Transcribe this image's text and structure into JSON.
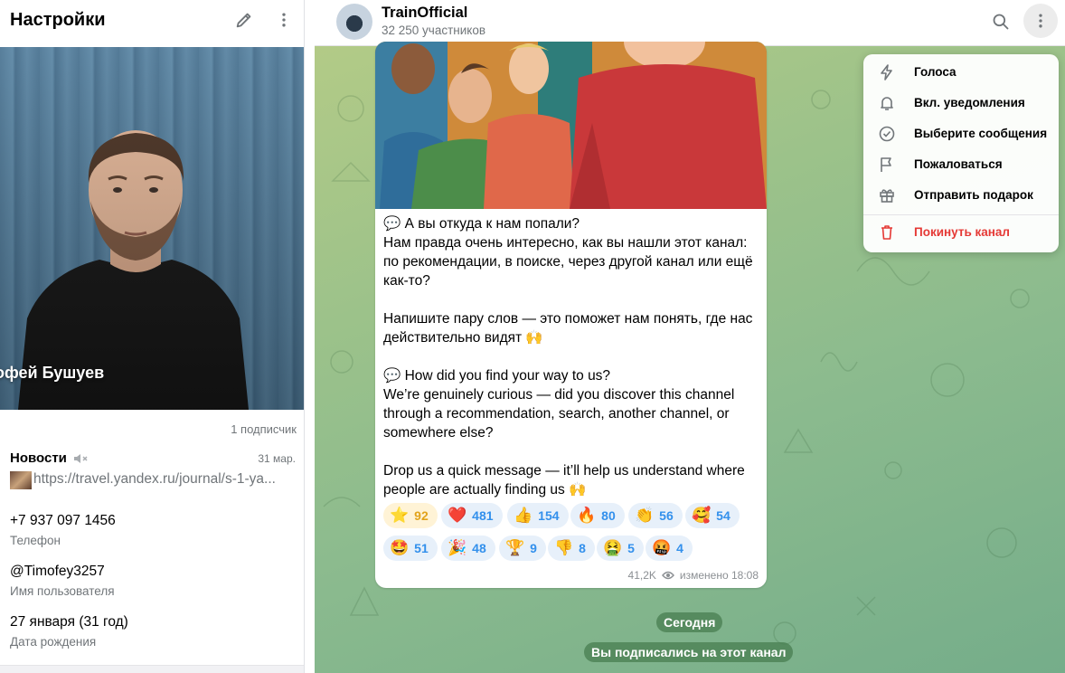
{
  "left_panel": {
    "title": "Настройки",
    "profile_name": "офей Бушуев",
    "subscribers": "1 подписчик",
    "news": {
      "title": "Новости",
      "date": "31 мар.",
      "link": "https://travel.yandex.ru/journal/s-1-ya..."
    },
    "phone": {
      "value": "+7 937 097 1456",
      "label": "Телефон"
    },
    "username": {
      "value": "@Timofey3257",
      "label": "Имя пользователя"
    },
    "birthday": {
      "value": "27 января (31 год)",
      "label": "Дата рождения"
    }
  },
  "chat": {
    "channel_name": "TrainOfficial",
    "members": "32 250 участников",
    "message": {
      "text": "💬 А вы откуда к нам попали?\nНам правда очень интересно, как вы нашли этот канал: по рекомендации, в поиске, через другой канал или ещё как-то?\n\nНапишите пару слов — это поможет нам понять, где нас действительно видят 🙌\n\n💬 How did you find your way to us?\nWe’re genuinely curious — did you discover this channel through a recommendation, search, another channel, or somewhere else?\n\nDrop us a quick message — it’ll help us understand where people are actually finding us 🙌",
      "reactions": [
        {
          "emoji": "⭐",
          "count": "92"
        },
        {
          "emoji": "❤️",
          "count": "481"
        },
        {
          "emoji": "👍",
          "count": "154"
        },
        {
          "emoji": "🔥",
          "count": "80"
        },
        {
          "emoji": "👏",
          "count": "56"
        },
        {
          "emoji": "🥰",
          "count": "54"
        },
        {
          "emoji": "🤩",
          "count": "51"
        },
        {
          "emoji": "🎉",
          "count": "48"
        },
        {
          "emoji": "🏆",
          "count": "9"
        },
        {
          "emoji": "👎",
          "count": "8"
        },
        {
          "emoji": "🤮",
          "count": "5"
        },
        {
          "emoji": "🤬",
          "count": "4"
        }
      ],
      "views": "41,2K",
      "edited": "изменено 18:08"
    },
    "date_pill": "Сегодня",
    "service_message": "Вы подписались на этот канал"
  },
  "menu": {
    "items": [
      {
        "label": "Голоса",
        "icon": "lightning-icon"
      },
      {
        "label": "Вкл. уведомления",
        "icon": "bell-icon"
      },
      {
        "label": "Выберите сообщения",
        "icon": "check-circle-icon"
      },
      {
        "label": "Пожаловаться",
        "icon": "flag-icon"
      },
      {
        "label": "Отправить подарок",
        "icon": "gift-icon"
      },
      {
        "label": "Покинуть канал",
        "icon": "trash-icon"
      }
    ]
  },
  "colors": {
    "accent": "#3390ec",
    "danger": "#e53935",
    "secondary_text": "#707579"
  }
}
